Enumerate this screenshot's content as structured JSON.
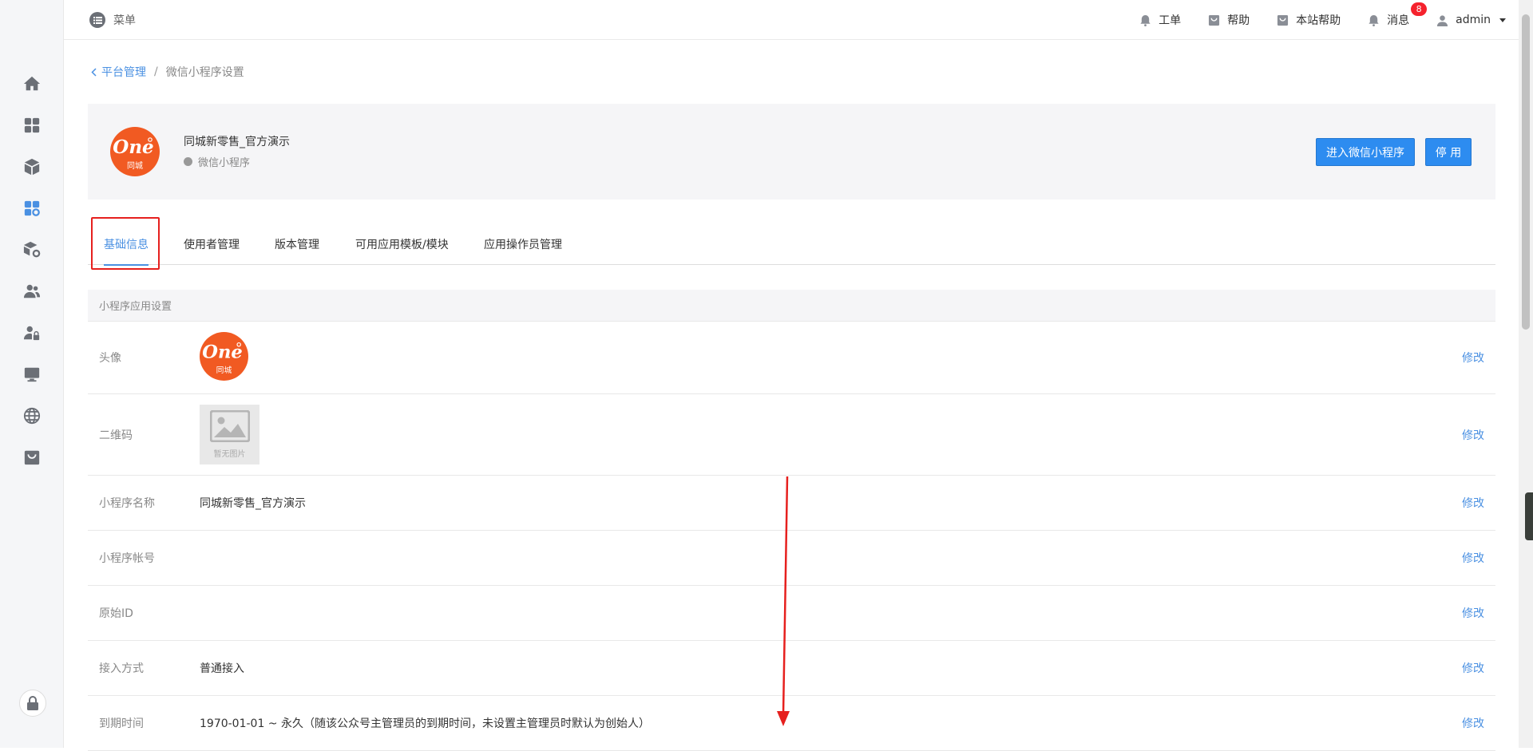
{
  "topbar": {
    "menu_label": "菜单",
    "items": [
      {
        "label": "工单",
        "icon": "bell-icon"
      },
      {
        "label": "帮助",
        "icon": "shop-bag-icon"
      },
      {
        "label": "本站帮助",
        "icon": "shop-bag-icon"
      },
      {
        "label": "消息",
        "icon": "bell-icon",
        "badge": "8"
      }
    ],
    "user": "admin"
  },
  "sidebar": {
    "icons": [
      "home-icon",
      "apps-grid-icon",
      "box-icon",
      "apps-settings-icon",
      "box-settings-icon",
      "users-icon",
      "user-lock-icon",
      "monitor-icon",
      "globe-icon",
      "shop-bag-icon",
      "lock-icon"
    ],
    "active": "apps-settings-icon"
  },
  "breadcrumb": {
    "parent": "平台管理",
    "separator": "/",
    "current": "微信小程序设置"
  },
  "app": {
    "name": "同城新零售_官方演示",
    "type": "微信小程序",
    "logo_text": "One",
    "logo_sub": "同城",
    "enter_button": "进入微信小程序",
    "disable_button": "停 用"
  },
  "tabs": [
    {
      "label": "基础信息",
      "active": true
    },
    {
      "label": "使用者管理"
    },
    {
      "label": "版本管理"
    },
    {
      "label": "可用应用模板/模块"
    },
    {
      "label": "应用操作员管理"
    }
  ],
  "section": {
    "title": "小程序应用设置"
  },
  "rows": [
    {
      "label": "头像",
      "value": "",
      "action": "修改"
    },
    {
      "label": "二维码",
      "value": "",
      "placeholder": "暂无图片",
      "action": "修改"
    },
    {
      "label": "小程序名称",
      "value": "同城新零售_官方演示",
      "action": "修改"
    },
    {
      "label": "小程序帐号",
      "value": "",
      "action": "修改"
    },
    {
      "label": "原始ID",
      "value": "",
      "action": "修改"
    },
    {
      "label": "接入方式",
      "value": "普通接入",
      "action": "修改"
    },
    {
      "label": "到期时间",
      "value": "1970-01-01 ~ 永久（随该公众号主管理员的到期时间，未设置主管理员时默认为创始人）",
      "action": "修改"
    }
  ],
  "colors": {
    "accent": "#4a90e2",
    "button": "#2d8cf0",
    "badge": "#f5222d",
    "logo": "#f15a22",
    "annotation": "#e6201e"
  }
}
